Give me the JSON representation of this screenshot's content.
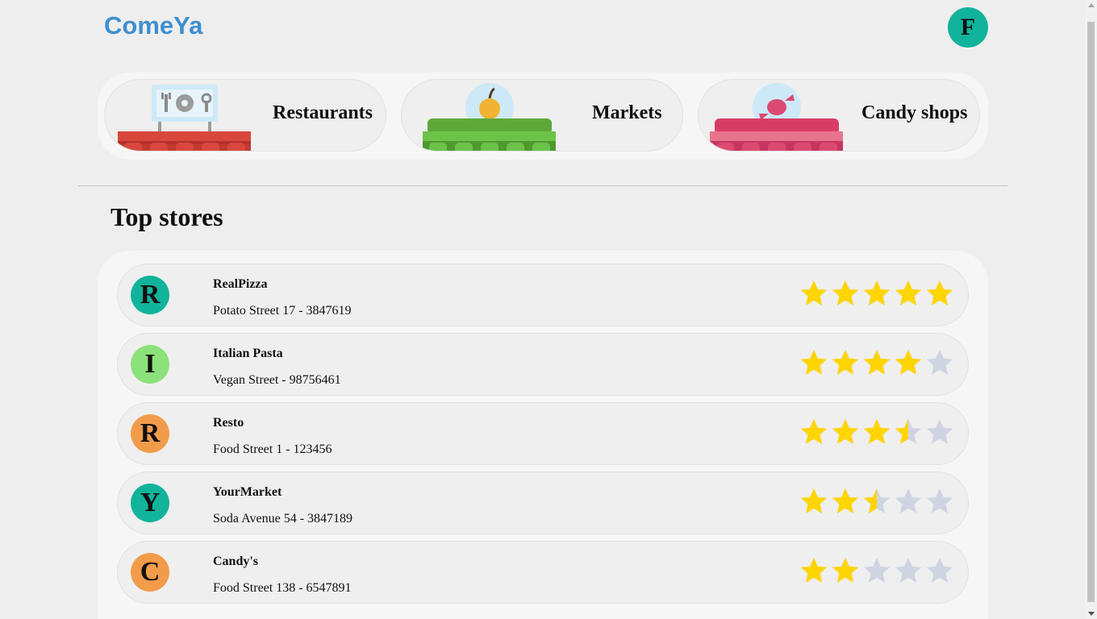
{
  "header": {
    "logo": "ComeYa",
    "avatar_letter": "F"
  },
  "categories": [
    {
      "label": "Restaurants",
      "icon": "restaurant-awning-icon",
      "awning_color": "#d9473c"
    },
    {
      "label": "Markets",
      "icon": "market-awning-icon",
      "awning_color": "#6cc349"
    },
    {
      "label": "Candy shops",
      "icon": "candy-awning-icon",
      "awning_color": "#dc4a72"
    }
  ],
  "top_stores": {
    "title": "Top stores",
    "stores": [
      {
        "initial": "R",
        "name": "RealPizza",
        "address": "Potato Street 17 - 3847619",
        "rating": 5,
        "avatar_color": "#12b39b"
      },
      {
        "initial": "I",
        "name": "Italian Pasta",
        "address": "Vegan Street - 98756461",
        "rating": 4,
        "avatar_color": "#8be27a"
      },
      {
        "initial": "R",
        "name": "Resto",
        "address": "Food Street 1 - 123456",
        "rating": 3.5,
        "avatar_color": "#f29c4b"
      },
      {
        "initial": "Y",
        "name": "YourMarket",
        "address": "Soda Avenue 54 - 3847189",
        "rating": 2.5,
        "avatar_color": "#12b39b"
      },
      {
        "initial": "C",
        "name": "Candy's",
        "address": "Food Street 138 - 6547891",
        "rating": 2,
        "avatar_color": "#f29c4b"
      }
    ]
  },
  "colors": {
    "accent": "#3d8fd0",
    "star_on": "#ffd500",
    "star_off": "#cfd4e2"
  }
}
